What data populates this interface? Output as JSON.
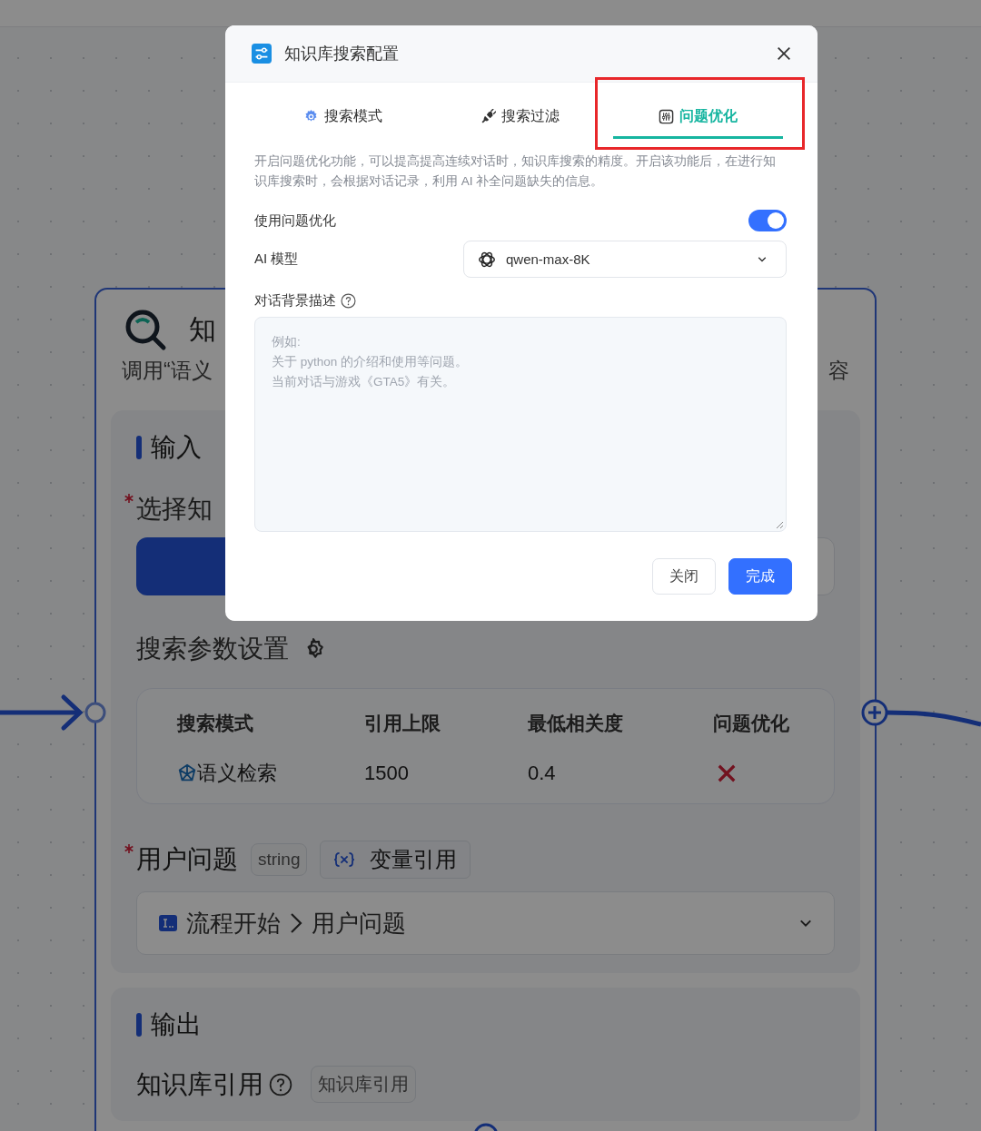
{
  "node": {
    "title": "知",
    "description": "调用“语义",
    "description_end": "容",
    "input": {
      "heading": "输入",
      "kb_label": "选择知",
      "kb_required": true
    },
    "search_params": {
      "heading": "搜索参数设置",
      "columns": [
        "搜索模式",
        "引用上限",
        "最低相关度",
        "问题优化"
      ],
      "row": {
        "mode": "语义检索",
        "limit": "1500",
        "min_relevance": "0.4",
        "optimize": false
      }
    },
    "question": {
      "label": "用户问题",
      "required": true,
      "type_tag": "string",
      "var_button": "变量引用",
      "path": [
        "流程开始",
        "用户问题"
      ]
    },
    "output": {
      "heading": "输出",
      "label": "知识库引用",
      "tag": "知识库引用"
    }
  },
  "dialog": {
    "title": "知识库搜索配置",
    "tabs": [
      {
        "label": "搜索模式",
        "selected": false,
        "highlighted": false
      },
      {
        "label": "搜索过滤",
        "selected": false,
        "highlighted": false
      },
      {
        "label": "问题优化",
        "selected": true,
        "highlighted": true
      }
    ],
    "description": "开启问题优化功能，可以提高提高连续对话时，知识库搜索的精度。开启该功能后，在进行知识库搜索时，会根据对话记录，利用 AI 补全问题缺失的信息。",
    "toggle": {
      "label": "使用问题优化",
      "on": true
    },
    "model": {
      "label": "AI 模型",
      "value": "qwen-max-8K"
    },
    "background": {
      "label": "对话背景描述",
      "placeholder_lines": [
        "例如:",
        "关于 python 的介绍和使用等问题。",
        "当前对话与游戏《GTA5》有关。"
      ]
    },
    "buttons": [
      {
        "label": "关闭",
        "kind": "secondary"
      },
      {
        "label": "完成",
        "kind": "primary"
      }
    ]
  }
}
